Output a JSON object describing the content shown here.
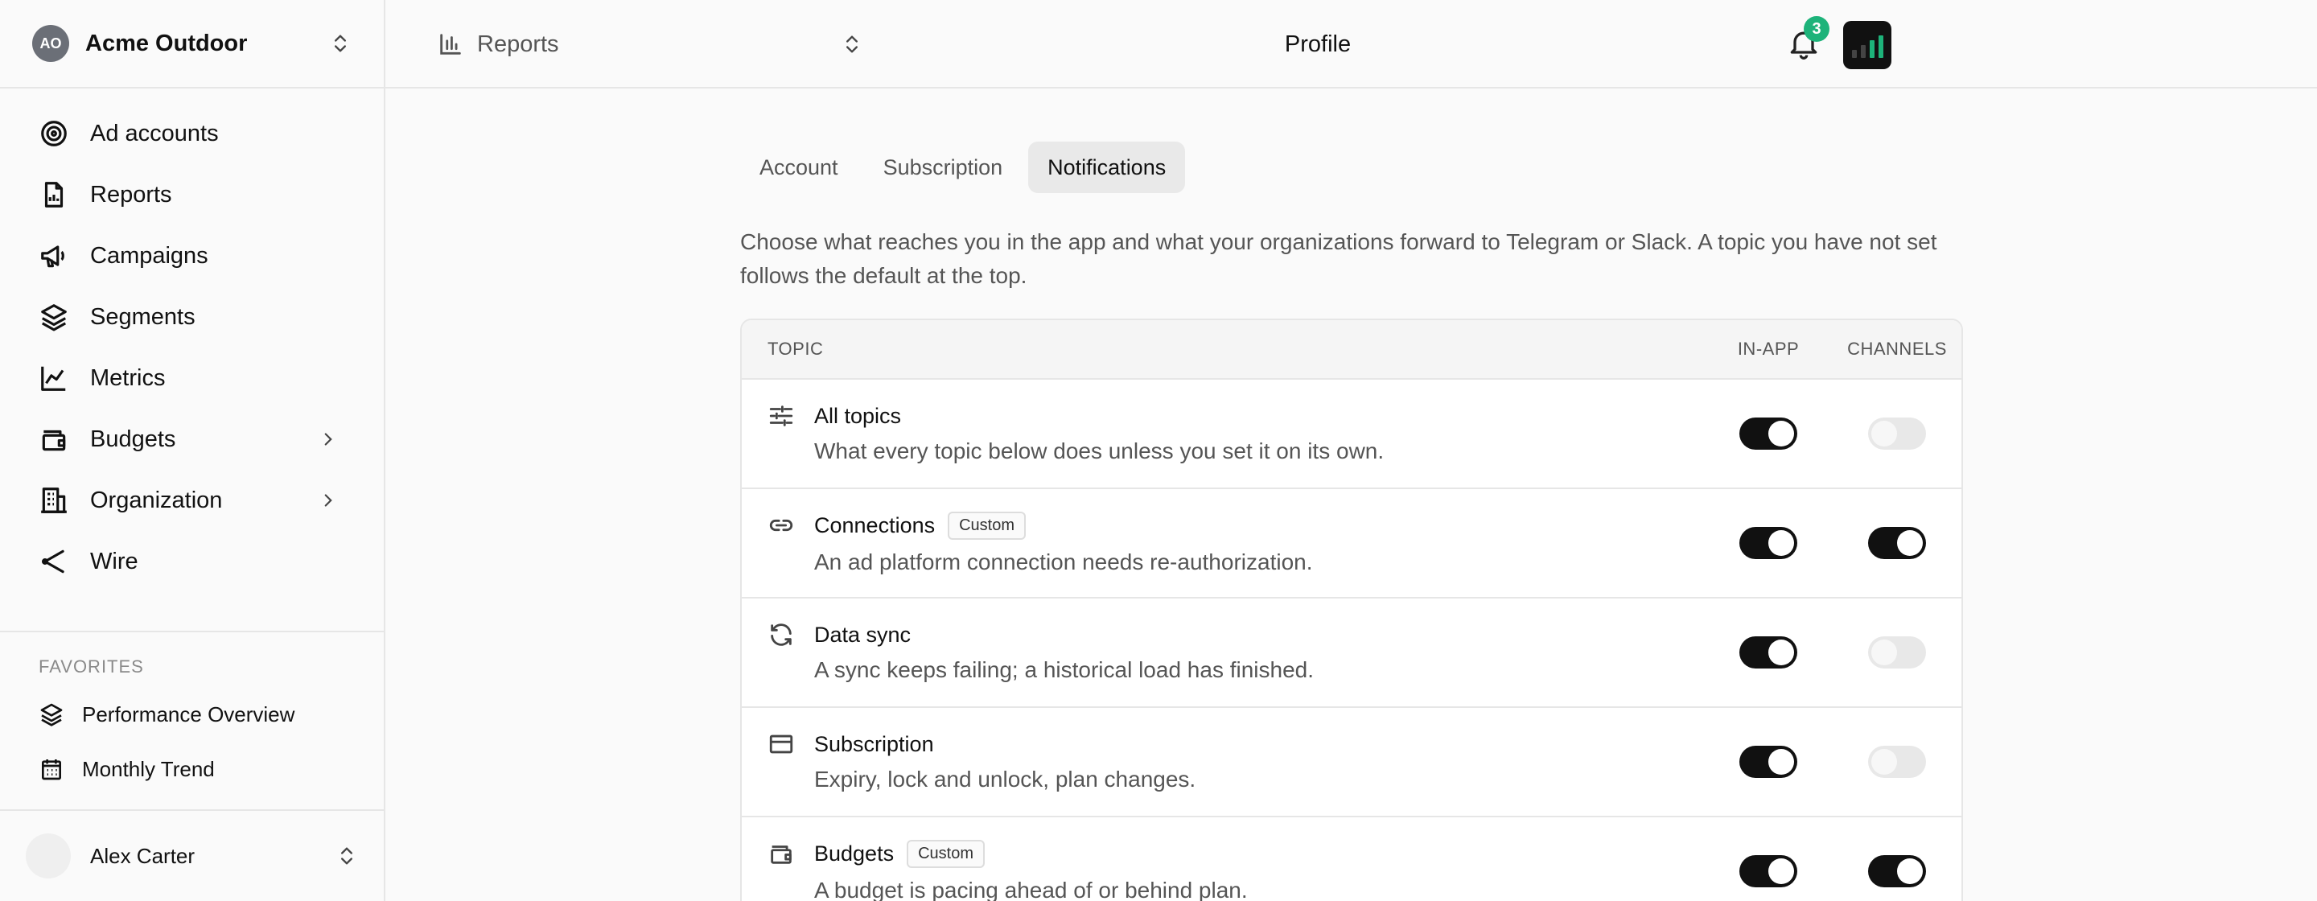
{
  "org": {
    "initials": "AO",
    "name": "Acme Outdoor"
  },
  "sidebar": {
    "items": [
      {
        "label": "Ad accounts",
        "icon": "target-icon",
        "chevron": false
      },
      {
        "label": "Reports",
        "icon": "report-file-icon",
        "chevron": false
      },
      {
        "label": "Campaigns",
        "icon": "megaphone-icon",
        "chevron": false
      },
      {
        "label": "Segments",
        "icon": "layers-icon",
        "chevron": false
      },
      {
        "label": "Metrics",
        "icon": "line-chart-icon",
        "chevron": false
      },
      {
        "label": "Budgets",
        "icon": "wallet-icon",
        "chevron": true
      },
      {
        "label": "Organization",
        "icon": "building-icon",
        "chevron": true
      },
      {
        "label": "Wire",
        "icon": "share-icon",
        "chevron": false
      }
    ],
    "favorites_title": "FAVORITES",
    "favorites": [
      {
        "label": "Performance Overview",
        "icon": "layers-icon"
      },
      {
        "label": "Monthly Trend",
        "icon": "calendar-icon"
      }
    ],
    "user_name": "Alex Carter"
  },
  "topbar": {
    "report_selector": "Reports",
    "title": "Profile",
    "notification_count": "3"
  },
  "tabs": [
    {
      "label": "Account",
      "active": false
    },
    {
      "label": "Subscription",
      "active": false
    },
    {
      "label": "Notifications",
      "active": true
    }
  ],
  "intro": "Choose what reaches you in the app and what your organizations forward to Telegram or Slack. A topic you have not set follows the default at the top.",
  "table": {
    "headers": {
      "topic": "TOPIC",
      "in_app": "IN-APP",
      "channels": "CHANNELS"
    },
    "rows": [
      {
        "title": "All topics",
        "badge": "",
        "desc": "What every topic below does unless you set it on its own.",
        "icon": "sliders-icon",
        "in_app": true,
        "channels": false
      },
      {
        "title": "Connections",
        "badge": "Custom",
        "desc": "An ad platform connection needs re-authorization.",
        "icon": "link-icon",
        "in_app": true,
        "channels": true
      },
      {
        "title": "Data sync",
        "badge": "",
        "desc": "A sync keeps failing; a historical load has finished.",
        "icon": "refresh-icon",
        "in_app": true,
        "channels": false
      },
      {
        "title": "Subscription",
        "badge": "",
        "desc": "Expiry, lock and unlock, plan changes.",
        "icon": "credit-card-icon",
        "in_app": true,
        "channels": false
      },
      {
        "title": "Budgets",
        "badge": "Custom",
        "desc": "A budget is pacing ahead of or behind plan.",
        "icon": "wallet-icon",
        "in_app": true,
        "channels": true
      }
    ]
  },
  "colors": {
    "accent": "#111111",
    "badge_green": "#1db37a",
    "logo_bar": "#1db37a"
  }
}
